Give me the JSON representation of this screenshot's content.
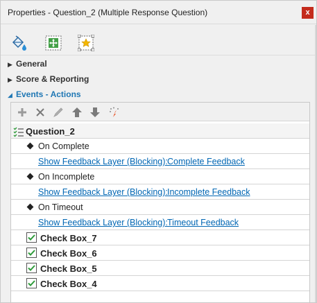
{
  "window": {
    "title": "Properties - Question_2 (Multiple Response Question)",
    "close_label": "x"
  },
  "tabs": [
    {
      "icon": "paint-bucket-icon"
    },
    {
      "icon": "size-position-icon"
    },
    {
      "icon": "star-state-icon"
    }
  ],
  "sections": {
    "general": "General",
    "score": "Score & Reporting",
    "events": "Events - Actions"
  },
  "toolbar": [
    {
      "icon": "add-icon",
      "glyph": "+"
    },
    {
      "icon": "delete-icon",
      "glyph": "✕"
    },
    {
      "icon": "edit-icon",
      "glyph": "✎"
    },
    {
      "icon": "move-up-icon",
      "glyph": "⬆"
    },
    {
      "icon": "move-down-icon",
      "glyph": "⬇"
    },
    {
      "icon": "magic-wand-icon",
      "glyph": "✦"
    }
  ],
  "tree": {
    "root": "Question_2",
    "on_complete": "On Complete",
    "on_complete_action": "Show Feedback Layer (Blocking):",
    "on_complete_target": "Complete Feedback",
    "on_incomplete": "On Incomplete",
    "on_incomplete_action": "Show Feedback Layer (Blocking):",
    "on_incomplete_target": "Incomplete Feedback",
    "on_timeout": "On Timeout",
    "on_timeout_action": "Show Feedback Layer (Blocking):",
    "on_timeout_target": "Timeout Feedback",
    "checkboxes": [
      "Check Box_7",
      "Check Box_6",
      "Check Box_5",
      "Check Box_4"
    ]
  },
  "colors": {
    "accent": "#1f77b4",
    "link": "#0066b3",
    "close": "#c42b1c",
    "check": "#2e9b3a"
  }
}
